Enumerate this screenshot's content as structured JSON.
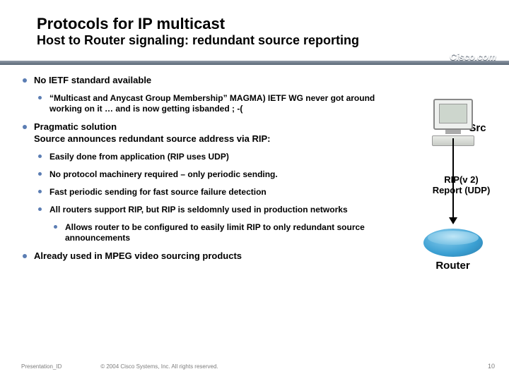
{
  "title": "Protocols for IP multicast",
  "subtitle": "Host to Router signaling: redundant source reporting",
  "brand": "Cisco.com",
  "bullets": {
    "b1": "No IETF standard available",
    "b1a": "“Multicast and Anycast  Group Membership” MAGMA) IETF WG never got around working on it … and is now getting isbanded ; -(",
    "b2": "Pragmatic solution\nSource announces redundant source address via RIP:",
    "b2a": "Easily done from application (RIP uses UDP)",
    "b2b": "No protocol machinery required – only periodic sending.",
    "b2c": "Fast periodic sending for fast source failure detection",
    "b2d": "All routers support RIP, but RIP is seldomnly used in production networks",
    "b2d1": "Allows router to be configured to easily limit RIP to only redundant source announcements",
    "b3": "Already used in MPEG video sourcing products"
  },
  "diagram": {
    "src": "Src",
    "rip": "RIP(v 2)\nReport (UDP)",
    "router": "Router"
  },
  "footer": {
    "pid": "Presentation_ID",
    "copy": "© 2004 Cisco Systems, Inc. All rights reserved.",
    "page": "10"
  }
}
